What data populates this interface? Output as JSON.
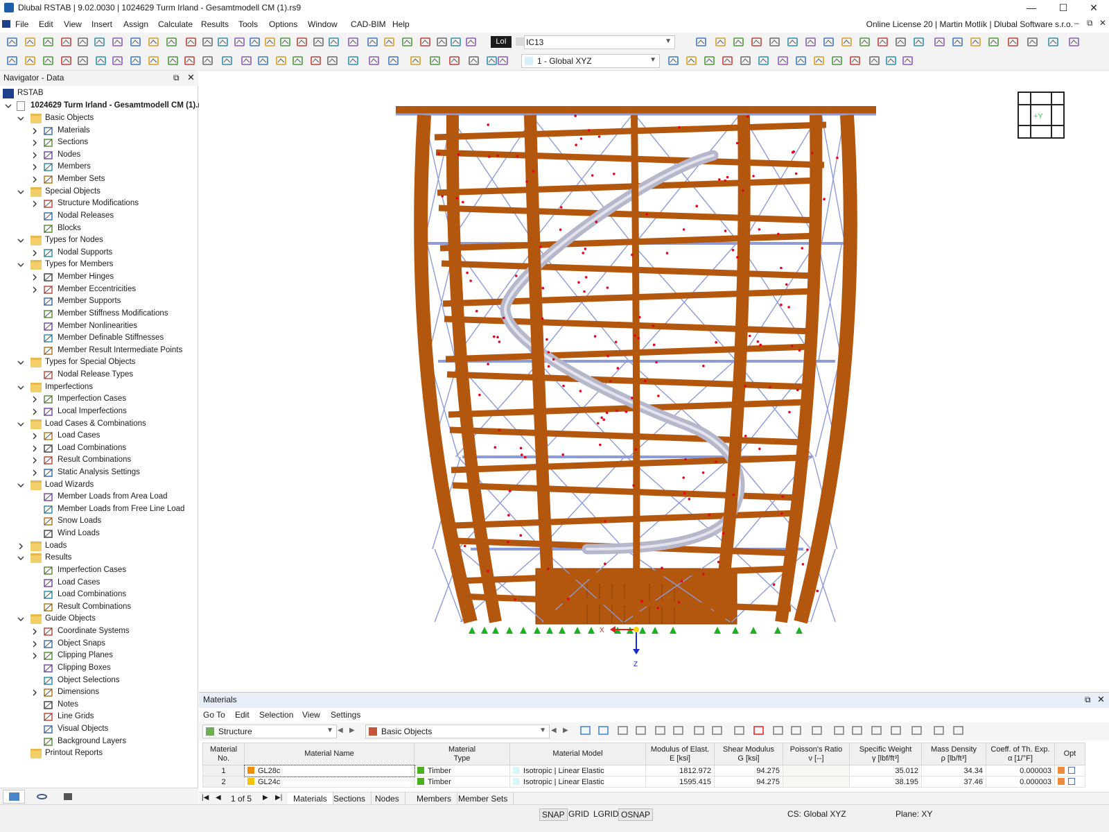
{
  "window": {
    "title": "Dlubal RSTAB | 9.02.0030 | 1024629 Turm Irland - Gesamtmodell CM (1).rs9",
    "minimize": "—",
    "maximize": "☐",
    "close": "✕"
  },
  "menu": {
    "items": [
      "File",
      "Edit",
      "View",
      "Insert",
      "Assign",
      "Calculate",
      "Results",
      "Tools",
      "Options",
      "Window",
      "CAD-BIM",
      "Help"
    ],
    "license": "Online License 20 | Martin Motlík | Dlubal Software s.r.o."
  },
  "toolbar": {
    "lol_label": "LoI",
    "combo_ic": "IC13",
    "combo_cs": "1 - Global XYZ"
  },
  "navigator": {
    "title": "Navigator - Data",
    "root": "RSTAB",
    "model": "1024629 Turm Irland - Gesamtmodell CM (1).rs9",
    "tree": [
      {
        "label": "Basic Objects",
        "level": 1,
        "expanded": true,
        "folder": true,
        "icon": "folder-icon"
      },
      {
        "label": "Materials",
        "level": 2,
        "chevron": true,
        "icon": "materials-icon"
      },
      {
        "label": "Sections",
        "level": 2,
        "chevron": true,
        "icon": "sections-icon"
      },
      {
        "label": "Nodes",
        "level": 2,
        "chevron": true,
        "icon": "nodes-icon"
      },
      {
        "label": "Members",
        "level": 2,
        "chevron": true,
        "icon": "members-icon"
      },
      {
        "label": "Member Sets",
        "level": 2,
        "chevron": true,
        "icon": "member-sets-icon"
      },
      {
        "label": "Special Objects",
        "level": 1,
        "expanded": true,
        "folder": true,
        "icon": "folder-icon"
      },
      {
        "label": "Structure Modifications",
        "level": 2,
        "chevron": true,
        "icon": "structure-modifications-icon"
      },
      {
        "label": "Nodal Releases",
        "level": 2,
        "chevron": false,
        "icon": "nodal-releases-icon"
      },
      {
        "label": "Blocks",
        "level": 2,
        "chevron": false,
        "icon": "blocks-icon"
      },
      {
        "label": "Types for Nodes",
        "level": 1,
        "expanded": true,
        "folder": true,
        "icon": "folder-icon"
      },
      {
        "label": "Nodal Supports",
        "level": 2,
        "chevron": true,
        "icon": "nodal-supports-icon"
      },
      {
        "label": "Types for Members",
        "level": 1,
        "expanded": true,
        "folder": true,
        "icon": "folder-icon"
      },
      {
        "label": "Member Hinges",
        "level": 2,
        "chevron": true,
        "icon": "member-hinges-icon"
      },
      {
        "label": "Member Eccentricities",
        "level": 2,
        "chevron": true,
        "icon": "member-eccentricities-icon"
      },
      {
        "label": "Member Supports",
        "level": 2,
        "chevron": false,
        "icon": "member-supports-icon"
      },
      {
        "label": "Member Stiffness Modifications",
        "level": 2,
        "chevron": false,
        "icon": "member-stiffness-icon"
      },
      {
        "label": "Member Nonlinearities",
        "level": 2,
        "chevron": false,
        "icon": "member-nonlinearities-icon"
      },
      {
        "label": "Member Definable Stiffnesses",
        "level": 2,
        "chevron": false,
        "icon": "member-definable-stiffnesses-icon"
      },
      {
        "label": "Member Result Intermediate Points",
        "level": 2,
        "chevron": false,
        "icon": "member-result-points-icon"
      },
      {
        "label": "Types for Special Objects",
        "level": 1,
        "expanded": true,
        "folder": true,
        "icon": "folder-icon"
      },
      {
        "label": "Nodal Release Types",
        "level": 2,
        "chevron": false,
        "icon": "nodal-release-types-icon"
      },
      {
        "label": "Imperfections",
        "level": 1,
        "expanded": true,
        "folder": true,
        "icon": "folder-icon"
      },
      {
        "label": "Imperfection Cases",
        "level": 2,
        "chevron": true,
        "icon": "imperfection-cases-icon"
      },
      {
        "label": "Local Imperfections",
        "level": 2,
        "chevron": true,
        "icon": "local-imperfections-icon"
      },
      {
        "label": "Load Cases & Combinations",
        "level": 1,
        "expanded": true,
        "folder": true,
        "icon": "folder-icon"
      },
      {
        "label": "Load Cases",
        "level": 2,
        "chevron": true,
        "icon": "load-cases-icon"
      },
      {
        "label": "Load Combinations",
        "level": 2,
        "chevron": true,
        "icon": "load-combinations-icon"
      },
      {
        "label": "Result Combinations",
        "level": 2,
        "chevron": true,
        "icon": "result-combinations-icon"
      },
      {
        "label": "Static Analysis Settings",
        "level": 2,
        "chevron": true,
        "icon": "static-analysis-icon"
      },
      {
        "label": "Load Wizards",
        "level": 1,
        "expanded": true,
        "folder": true,
        "icon": "folder-icon"
      },
      {
        "label": "Member Loads from Area Load",
        "level": 2,
        "chevron": false,
        "icon": "area-load-icon"
      },
      {
        "label": "Member Loads from Free Line Load",
        "level": 2,
        "chevron": false,
        "icon": "free-line-load-icon"
      },
      {
        "label": "Snow Loads",
        "level": 2,
        "chevron": false,
        "icon": "snow-icon"
      },
      {
        "label": "Wind Loads",
        "level": 2,
        "chevron": false,
        "icon": "wind-icon"
      },
      {
        "label": "Loads",
        "level": 1,
        "expanded": false,
        "folder": true,
        "icon": "folder-icon"
      },
      {
        "label": "Results",
        "level": 1,
        "expanded": true,
        "folder": true,
        "icon": "folder-icon"
      },
      {
        "label": "Imperfection Cases",
        "level": 2,
        "chevron": false,
        "icon": "imperfection-cases-icon"
      },
      {
        "label": "Load Cases",
        "level": 2,
        "chevron": false,
        "icon": "load-cases-icon"
      },
      {
        "label": "Load Combinations",
        "level": 2,
        "chevron": false,
        "icon": "load-combinations-icon"
      },
      {
        "label": "Result Combinations",
        "level": 2,
        "chevron": false,
        "icon": "result-combinations-icon"
      },
      {
        "label": "Guide Objects",
        "level": 1,
        "expanded": true,
        "folder": true,
        "icon": "folder-icon"
      },
      {
        "label": "Coordinate Systems",
        "level": 2,
        "chevron": true,
        "icon": "coordinate-systems-icon"
      },
      {
        "label": "Object Snaps",
        "level": 2,
        "chevron": true,
        "icon": "object-snaps-icon"
      },
      {
        "label": "Clipping Planes",
        "level": 2,
        "chevron": true,
        "icon": "clipping-planes-icon"
      },
      {
        "label": "Clipping Boxes",
        "level": 2,
        "chevron": false,
        "icon": "clipping-boxes-icon"
      },
      {
        "label": "Object Selections",
        "level": 2,
        "chevron": false,
        "icon": "object-selections-icon"
      },
      {
        "label": "Dimensions",
        "level": 2,
        "chevron": true,
        "icon": "dimensions-icon"
      },
      {
        "label": "Notes",
        "level": 2,
        "chevron": false,
        "icon": "notes-icon"
      },
      {
        "label": "Line Grids",
        "level": 2,
        "chevron": false,
        "icon": "line-grids-icon"
      },
      {
        "label": "Visual Objects",
        "level": 2,
        "chevron": false,
        "icon": "visual-objects-icon"
      },
      {
        "label": "Background Layers",
        "level": 2,
        "chevron": false,
        "icon": "background-layers-icon"
      },
      {
        "label": "Printout Reports",
        "level": 1,
        "expanded": null,
        "folder": true,
        "icon": "folder-icon"
      }
    ]
  },
  "viewport": {
    "view_cube_label": "+Y",
    "axis_z": "Z",
    "axis_x": "X",
    "colors": {
      "timber": "#b4570e",
      "steel_brace": "#8d9bd8",
      "slide": "#b7b7cc",
      "node": "#e8001c",
      "support": "#19b21e"
    }
  },
  "materials": {
    "title": "Materials",
    "menu": [
      "Go To",
      "Edit",
      "Selection",
      "View",
      "Settings"
    ],
    "filter1": "Structure",
    "filter2": "Basic Objects",
    "columns": [
      {
        "l1": "Material",
        "l2": "No."
      },
      {
        "l1": "",
        "l2": "Material Name"
      },
      {
        "l1": "Material",
        "l2": "Type"
      },
      {
        "l1": "",
        "l2": "Material Model"
      },
      {
        "l1": "Modulus of Elast.",
        "l2": "E [ksi]"
      },
      {
        "l1": "Shear Modulus",
        "l2": "G [ksi]"
      },
      {
        "l1": "Poisson's Ratio",
        "l2": "ν [--]"
      },
      {
        "l1": "Specific Weight",
        "l2": "γ [lbf/ft³]"
      },
      {
        "l1": "Mass Density",
        "l2": "ρ [lb/ft³]"
      },
      {
        "l1": "Coeff. of Th. Exp.",
        "l2": "α [1/°F]"
      },
      {
        "l1": "",
        "l2": "Opt"
      }
    ],
    "rows": [
      {
        "no": "1",
        "name": "GL28c",
        "name_color": "#f28c00",
        "type": "Timber",
        "type_color": "#4caf1f",
        "model": "Isotropic | Linear Elastic",
        "model_color": "#d8f7f7",
        "e": "1812.972",
        "g": "94.275",
        "nu": "",
        "gamma": "35.012",
        "rho": "34.34",
        "alpha": "0.000003"
      },
      {
        "no": "2",
        "name": "GL24c",
        "name_color": "#f5c400",
        "type": "Timber",
        "type_color": "#4caf1f",
        "model": "Isotropic | Linear Elastic",
        "model_color": "#d8f7f7",
        "e": "1595.415",
        "g": "94.275",
        "nu": "",
        "gamma": "38.195",
        "rho": "37.46",
        "alpha": "0.000003"
      }
    ],
    "pager": "1 of 5",
    "tabs": [
      "Materials",
      "Sections",
      "Nodes",
      "Members",
      "Member Sets"
    ]
  },
  "statusbar": {
    "toggles": [
      "SNAP",
      "GRID",
      "LGRID",
      "OSNAP"
    ],
    "cs": "CS: Global XYZ",
    "plane": "Plane: XY"
  }
}
